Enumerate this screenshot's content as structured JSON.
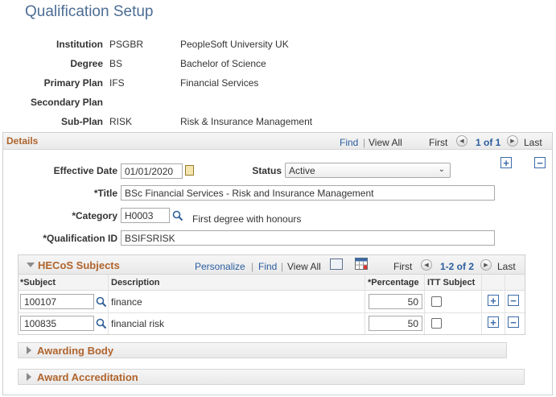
{
  "page": {
    "title": "Qualification Setup"
  },
  "header": {
    "institution": {
      "label": "Institution",
      "code": "PSGBR",
      "desc": "PeopleSoft University UK"
    },
    "degree": {
      "label": "Degree",
      "code": "BS",
      "desc": "Bachelor of Science"
    },
    "primary_plan": {
      "label": "Primary Plan",
      "code": "IFS",
      "desc": "Financial Services"
    },
    "secondary_plan": {
      "label": "Secondary Plan",
      "code": "",
      "desc": ""
    },
    "sub_plan": {
      "label": "Sub-Plan",
      "code": "RISK",
      "desc": "Risk & Insurance Management"
    }
  },
  "details": {
    "title": "Details",
    "nav": {
      "find": "Find",
      "sep": "|",
      "view_all": "View All",
      "first": "First",
      "count": "1 of 1",
      "last": "Last"
    },
    "effective_date": {
      "label": "Effective Date",
      "value": "01/01/2020"
    },
    "status": {
      "label": "Status",
      "value": "Active"
    },
    "title_field": {
      "label": "*Title",
      "value": "BSc Financial Services - Risk and Insurance Management"
    },
    "category": {
      "label": "*Category",
      "value": "H0003",
      "desc": "First degree with honours"
    },
    "qualification_id": {
      "label": "*Qualification ID",
      "value": "BSIFSRISK"
    }
  },
  "hecos": {
    "title": "HECoS Subjects",
    "nav": {
      "personalize": "Personalize",
      "sep": "|",
      "find": "Find",
      "view_all": "View All",
      "first": "First",
      "count": "1-2 of 2",
      "last": "Last"
    },
    "columns": {
      "subject": "*Subject",
      "description": "Description",
      "percentage": "*Percentage",
      "itt": "ITT Subject"
    },
    "rows": [
      {
        "subject": "100107",
        "description": "finance",
        "percentage": "50"
      },
      {
        "subject": "100835",
        "description": "financial risk",
        "percentage": "50"
      }
    ]
  },
  "sections": {
    "awarding_body": "Awarding Body",
    "award_accreditation": "Award Accreditation"
  },
  "colors": {
    "title": "#4d6d94",
    "section_title": "#b0642d",
    "link": "#2a5d9f"
  }
}
